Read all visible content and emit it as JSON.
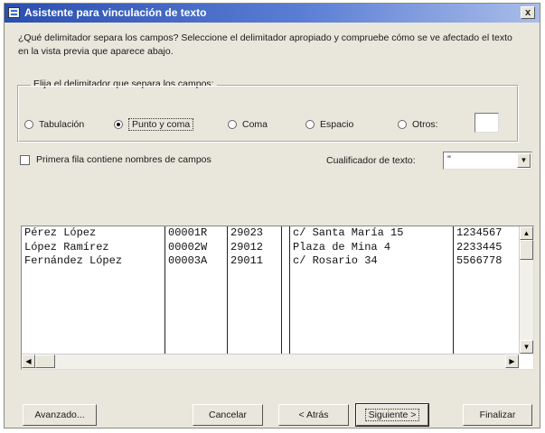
{
  "window": {
    "title": "Asistente para vinculación de texto",
    "close_glyph": "x"
  },
  "instructions": "¿Qué delimitador separa los campos? Seleccione el delimitador apropiado y compruebe cómo se ve afectado el texto en la vista previa que aparece abajo.",
  "delimiter_group": {
    "label": "Elija el delimitador que separa los campos:",
    "options": [
      {
        "label": "Tabulación",
        "selected": false
      },
      {
        "label": "Punto y coma",
        "selected": true
      },
      {
        "label": "Coma",
        "selected": false
      },
      {
        "label": "Espacio",
        "selected": false
      },
      {
        "label": "Otros:",
        "selected": false
      }
    ],
    "others_value": ""
  },
  "first_row_checkbox": {
    "label": "Primera fila contiene nombres de campos",
    "checked": false
  },
  "text_qualifier": {
    "label": "Cualificador de texto:",
    "value": "\""
  },
  "preview": {
    "columns": [
      [
        "Pérez López",
        "López Ramírez",
        "Fernández López"
      ],
      [
        "00001R",
        "00002W",
        "00003A"
      ],
      [
        "29023",
        "29012",
        "29011"
      ],
      [
        "",
        "",
        ""
      ],
      [
        "c/ Santa María 15",
        "Plaza de Mina 4",
        "c/ Rosario 34"
      ],
      [
        "1234567",
        "2233445",
        "5566778"
      ]
    ]
  },
  "buttons": {
    "advanced": "Avanzado...",
    "cancel": "Cancelar",
    "back": "< Atrás",
    "next": "Siguiente >",
    "finish": "Finalizar"
  }
}
